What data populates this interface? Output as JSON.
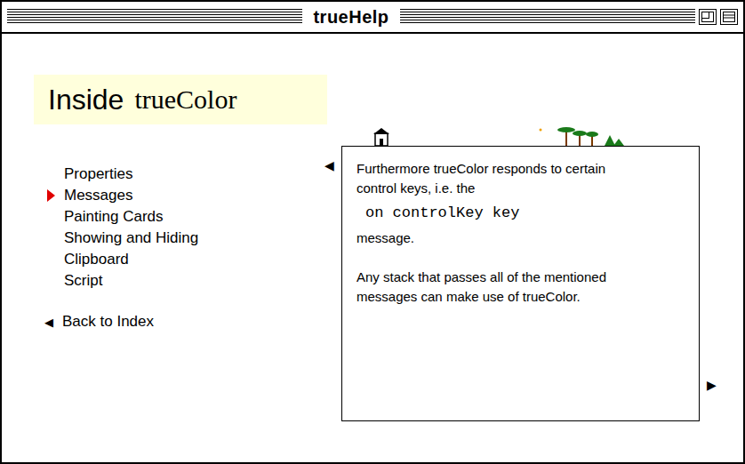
{
  "window": {
    "title": "trueHelp"
  },
  "header": {
    "prefix": "Inside",
    "name": "trueColor"
  },
  "menu": [
    {
      "label": "Properties",
      "selected": false
    },
    {
      "label": "Messages",
      "selected": true
    },
    {
      "label": "Painting Cards",
      "selected": false
    },
    {
      "label": "Showing and Hiding",
      "selected": false
    },
    {
      "label": "Clipboard",
      "selected": false
    },
    {
      "label": "Script",
      "selected": false
    }
  ],
  "back": {
    "icon": "◀",
    "label": "Back to Index"
  },
  "page": {
    "prev": "◀",
    "next": "▶",
    "paragraphs": [
      {
        "kind": "text",
        "text": "Furthermore trueColor responds to certain control keys, i.e. the"
      },
      {
        "kind": "code",
        "text": "on controlKey key"
      },
      {
        "kind": "text",
        "text": "message."
      },
      {
        "kind": "gap",
        "text": ""
      },
      {
        "kind": "text",
        "text": "Any stack that passes all of the mentioned messages can make use of trueColor."
      }
    ]
  }
}
